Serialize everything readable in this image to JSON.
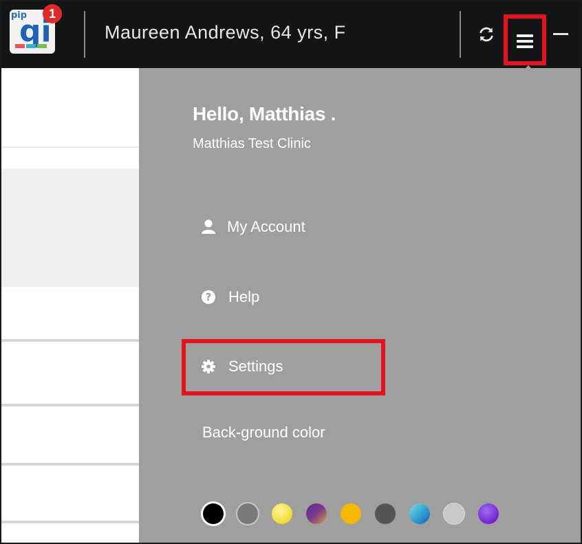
{
  "header": {
    "logo_text": "pip qi",
    "notification_count": "1",
    "patient_label": "Maureen Andrews, 64 yrs, F",
    "refresh_icon": "refresh-icon",
    "menu_icon": "hamburger-menu-icon",
    "minimize_icon": "minimize-icon"
  },
  "menu": {
    "greeting": "Hello, Matthias .",
    "clinic": "Matthias Test Clinic",
    "items": [
      {
        "label": "My Account",
        "icon": "user-icon"
      },
      {
        "label": "Help",
        "icon": "question-circle-icon"
      },
      {
        "label": "Settings",
        "icon": "gear-icon"
      }
    ],
    "background_label": "Back-ground color",
    "swatches": [
      {
        "name": "black",
        "color": "#000000"
      },
      {
        "name": "gray",
        "color": "#7a7a7a"
      },
      {
        "name": "yellow",
        "color": "#f6e04a"
      },
      {
        "name": "purple-gold",
        "color": "#7b3a8c"
      },
      {
        "name": "amber",
        "color": "#f5b800"
      },
      {
        "name": "dark-gray",
        "color": "#555555"
      },
      {
        "name": "teal-blue",
        "color": "#2e9fd0"
      },
      {
        "name": "light-gray",
        "color": "#c9c9c9"
      },
      {
        "name": "violet",
        "color": "#7a2bd6"
      }
    ]
  },
  "colors": {
    "panel_bg": "#9f9f9f",
    "topbar_bg": "#141517",
    "highlight": "#e3141c"
  }
}
